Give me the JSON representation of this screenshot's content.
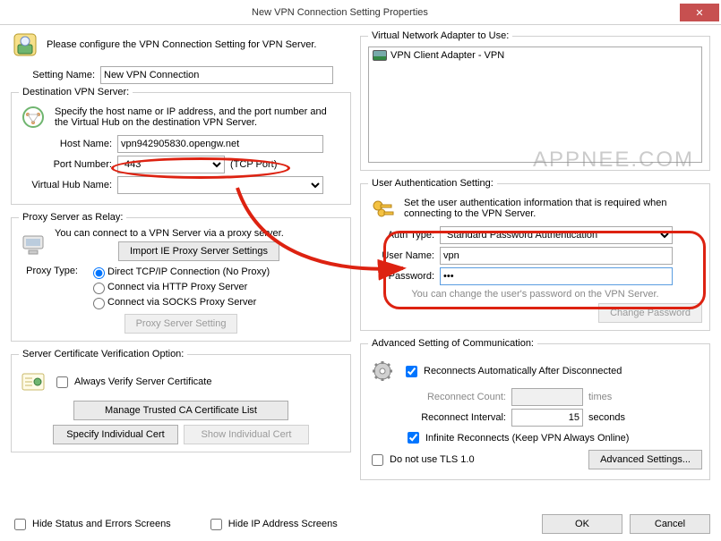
{
  "titlebar": {
    "title": "New VPN Connection Setting Properties"
  },
  "intro": "Please configure the VPN Connection Setting for VPN Server.",
  "setting_name": {
    "label": "Setting Name:",
    "value": "New VPN Connection"
  },
  "dest": {
    "legend": "Destination VPN Server:",
    "hint": "Specify the host name or IP address, and the port number and the Virtual Hub on the destination VPN Server.",
    "host_label": "Host Name:",
    "host_value": "vpn942905830.opengw.net",
    "port_label": "Port Number:",
    "port_value": "443",
    "port_suffix": "(TCP Port)",
    "hub_label": "Virtual Hub Name:",
    "hub_value": ""
  },
  "proxy": {
    "legend": "Proxy Server as Relay:",
    "hint": "You can connect to a VPN Server via a proxy server.",
    "import_btn": "Import IE Proxy Server Settings",
    "type_label": "Proxy Type:",
    "opt_direct": "Direct TCP/IP Connection (No Proxy)",
    "opt_http": "Connect via HTTP Proxy Server",
    "opt_socks": "Connect via SOCKS Proxy Server",
    "setting_btn": "Proxy Server Setting"
  },
  "cert": {
    "legend": "Server Certificate Verification Option:",
    "always": "Always Verify Server Certificate",
    "manage_btn": "Manage Trusted CA Certificate List",
    "specify_btn": "Specify Individual Cert",
    "show_btn": "Show Individual Cert"
  },
  "adapter": {
    "legend": "Virtual Network Adapter to Use:",
    "item": "VPN Client Adapter - VPN"
  },
  "auth": {
    "legend": "User Authentication Setting:",
    "hint": "Set the user authentication information that is required when connecting to the VPN Server.",
    "type_label": "Auth Type:",
    "type_value": "Standard Password Authentication",
    "user_label": "User Name:",
    "user_value": "vpn",
    "pass_label": "Password:",
    "pass_value": "•••",
    "note": "You can change the user's password on the VPN Server.",
    "change_btn": "Change Password"
  },
  "adv": {
    "legend": "Advanced Setting of Communication:",
    "reconnect_auto": "Reconnects Automatically After Disconnected",
    "count_label": "Reconnect Count:",
    "count_suffix": "times",
    "interval_label": "Reconnect Interval:",
    "interval_value": "15",
    "interval_suffix": "seconds",
    "infinite": "Infinite Reconnects (Keep VPN Always Online)",
    "notls": "Do not use TLS 1.0",
    "adv_btn": "Advanced Settings..."
  },
  "bottom": {
    "hide_status": "Hide Status and Errors Screens",
    "hide_ip": "Hide IP Address Screens",
    "ok": "OK",
    "cancel": "Cancel"
  },
  "watermark": "APPNEE.COM"
}
